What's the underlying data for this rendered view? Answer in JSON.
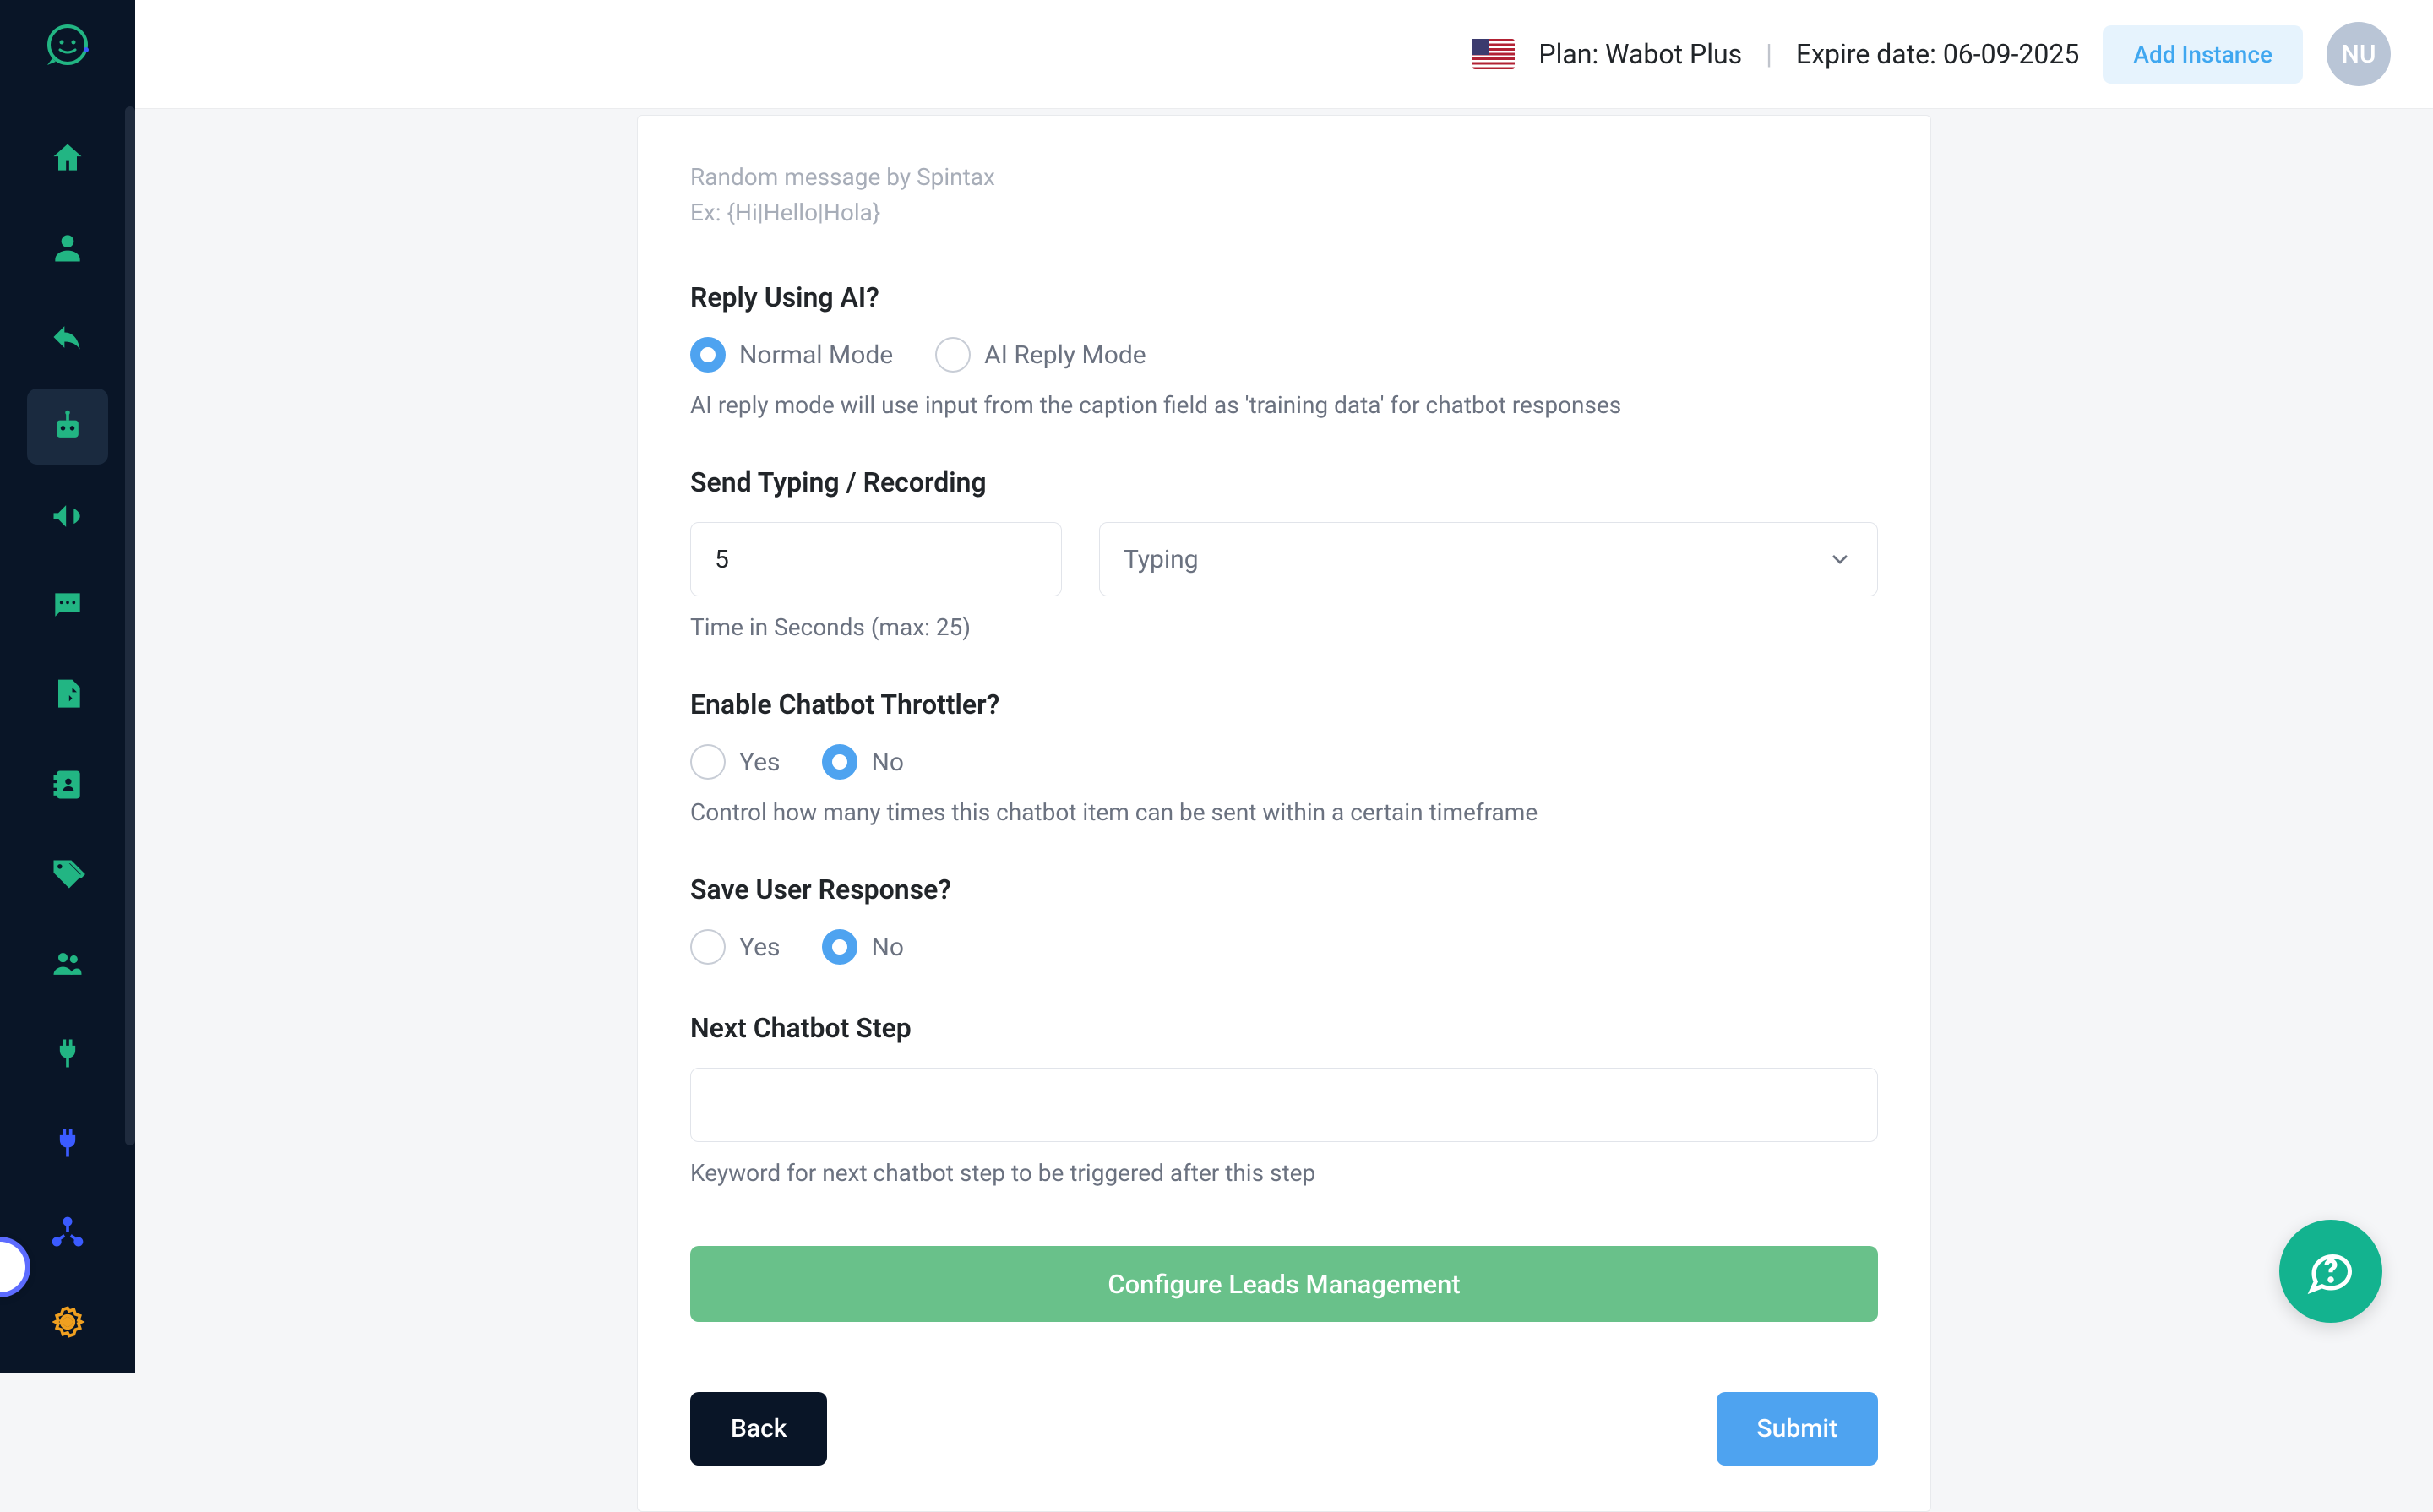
{
  "header": {
    "plan_label": "Plan: Wabot Plus",
    "expire_label": "Expire date: 06-09-2025",
    "add_instance_label": "Add Instance",
    "avatar_initials": "NU"
  },
  "form": {
    "spintax_hint_line1": "Random message by Spintax",
    "spintax_hint_line2": "Ex: {Hi|Hello|Hola}",
    "reply_ai": {
      "title": "Reply Using AI?",
      "normal_label": "Normal Mode",
      "ai_label": "AI Reply Mode",
      "help": "AI reply mode will use input from the caption field as 'training data' for chatbot responses",
      "selected": "normal"
    },
    "typing": {
      "title": "Send Typing / Recording",
      "seconds_value": "5",
      "type_value": "Typing",
      "help": "Time in Seconds (max: 25)"
    },
    "throttler": {
      "title": "Enable Chatbot Throttler?",
      "yes_label": "Yes",
      "no_label": "No",
      "help": "Control how many times this chatbot item can be sent within a certain timeframe",
      "selected": "no"
    },
    "save_response": {
      "title": "Save User Response?",
      "yes_label": "Yes",
      "no_label": "No",
      "selected": "no"
    },
    "next_step": {
      "title": "Next Chatbot Step",
      "value": "",
      "help": "Keyword for next chatbot step to be triggered after this step"
    },
    "leads_btn_label": "Configure Leads Management",
    "back_label": "Back",
    "submit_label": "Submit"
  },
  "sidebar": {
    "items": [
      {
        "name": "home",
        "color": "#22b583"
      },
      {
        "name": "user",
        "color": "#22b583"
      },
      {
        "name": "reply",
        "color": "#22b583"
      },
      {
        "name": "robot",
        "color": "#22b583",
        "active": true
      },
      {
        "name": "megaphone",
        "color": "#22b583"
      },
      {
        "name": "chat",
        "color": "#22b583"
      },
      {
        "name": "export",
        "color": "#22b583"
      },
      {
        "name": "contacts",
        "color": "#22b583"
      },
      {
        "name": "tags",
        "color": "#22b583"
      },
      {
        "name": "users",
        "color": "#22b583"
      },
      {
        "name": "plug",
        "color": "#22b583"
      },
      {
        "name": "plug2",
        "color": "#3b5bff"
      },
      {
        "name": "nodes",
        "color": "#3b5bff"
      },
      {
        "name": "gear",
        "color": "#f0a020"
      }
    ]
  }
}
